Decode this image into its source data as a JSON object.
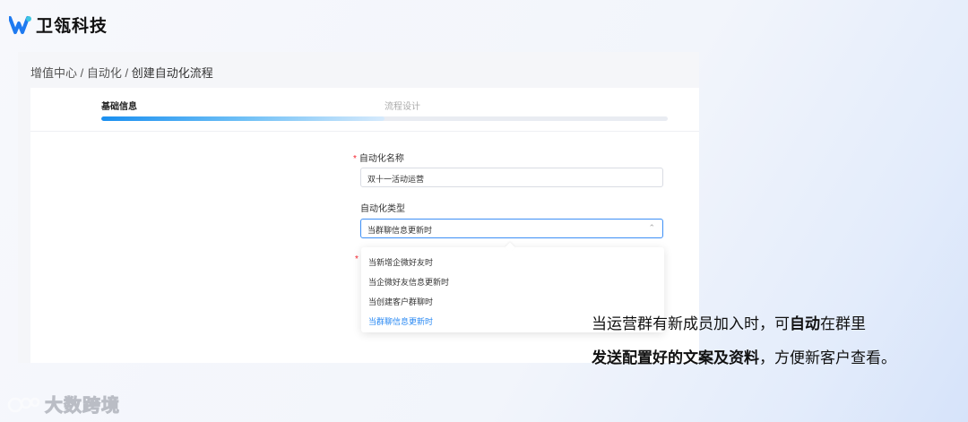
{
  "brand": {
    "name": "卫瓴科技"
  },
  "breadcrumb": {
    "part1": "增值中心",
    "sep": " / ",
    "part2": "自动化",
    "current": "创建自动化流程"
  },
  "steps": [
    {
      "label": "基础信息"
    },
    {
      "label": "流程设计"
    }
  ],
  "progress": {
    "fraction": 0.5
  },
  "form": {
    "name_label": "自动化名称",
    "name_value": "双十一活动运营",
    "type_label": "自动化类型",
    "type_value": "当群聊信息更新时",
    "required_mark": "*"
  },
  "dropdown": {
    "options": [
      {
        "label": "当新增企微好友时",
        "active": false
      },
      {
        "label": "当企微好友信息更新时",
        "active": false
      },
      {
        "label": "当创建客户群聊时",
        "active": false
      },
      {
        "label": "当群聊信息更新时",
        "active": true
      }
    ]
  },
  "caption": {
    "line1_a": "当运营群有新成员加入时，可",
    "line1_bold": "自动",
    "line1_b": "在群里",
    "line2_bold": "发送配置好的文案及资料",
    "line2_b": "，方便新客户查看。"
  },
  "watermark": {
    "text": "大数跨境"
  },
  "colors": {
    "accent": "#2b8af3",
    "required": "#f5222d",
    "brand": "#1e7af0"
  },
  "icons": {
    "logo": "weiling-logo",
    "watermark": "dashu-logo-icon",
    "select": "chevron-up-icon"
  }
}
